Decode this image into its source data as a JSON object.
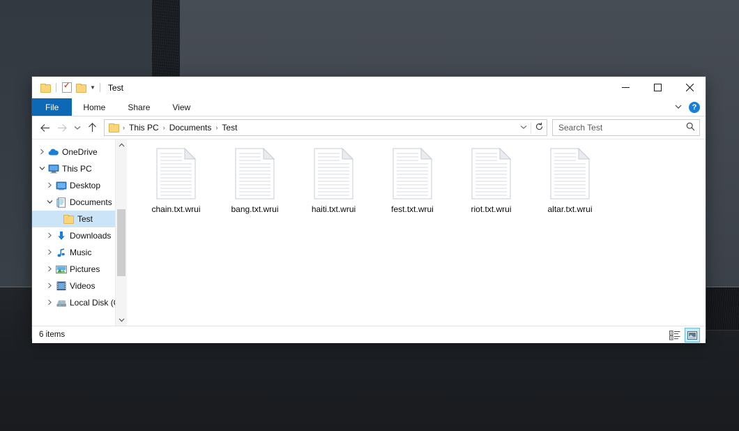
{
  "window": {
    "title": "Test",
    "quick_access": [
      {
        "icon": "folder-icon",
        "name": "qat-folder-icon"
      },
      {
        "icon": "properties-icon",
        "name": "qat-properties-icon"
      },
      {
        "icon": "new-folder-icon",
        "name": "qat-new-folder-icon"
      },
      {
        "icon": "chevron-down-icon",
        "name": "qat-customize-icon"
      }
    ],
    "controls": {
      "minimize": "–",
      "maximize": "☐",
      "close": "✕"
    }
  },
  "ribbon": {
    "tabs": [
      {
        "label": "File",
        "active": true
      },
      {
        "label": "Home",
        "active": false
      },
      {
        "label": "Share",
        "active": false
      },
      {
        "label": "View",
        "active": false
      }
    ],
    "expand_icon": "chevron-down-icon",
    "help_label": "?"
  },
  "toolbar": {
    "back_glyph": "←",
    "forward_glyph": "→",
    "recent_glyph": "⌄",
    "up_glyph": "↑",
    "address_dropdown_glyph": "⌄",
    "refresh_glyph": "↻",
    "breadcrumbs": [
      "This PC",
      "Documents",
      "Test"
    ],
    "breadcrumb_separator": "›"
  },
  "search": {
    "placeholder": "Search Test",
    "value": "",
    "icon": "search-icon"
  },
  "sidebar": {
    "items": [
      {
        "label": "OneDrive",
        "icon": "onedrive-icon",
        "arrow": "collapsed",
        "indent": 0,
        "selected": false
      },
      {
        "label": "This PC",
        "icon": "monitor-icon",
        "arrow": "expanded",
        "indent": 0,
        "selected": false
      },
      {
        "label": "Desktop",
        "icon": "desktop-icon",
        "arrow": "collapsed",
        "indent": 1,
        "selected": false
      },
      {
        "label": "Documents",
        "icon": "documents-icon",
        "arrow": "expanded",
        "indent": 1,
        "selected": false
      },
      {
        "label": "Test",
        "icon": "folder-icon",
        "arrow": "none",
        "indent": 2,
        "selected": true
      },
      {
        "label": "Downloads",
        "icon": "downloads-icon",
        "arrow": "collapsed",
        "indent": 1,
        "selected": false
      },
      {
        "label": "Music",
        "icon": "music-icon",
        "arrow": "collapsed",
        "indent": 1,
        "selected": false
      },
      {
        "label": "Pictures",
        "icon": "pictures-icon",
        "arrow": "collapsed",
        "indent": 1,
        "selected": false
      },
      {
        "label": "Videos",
        "icon": "videos-icon",
        "arrow": "collapsed",
        "indent": 1,
        "selected": false
      },
      {
        "label": "Local Disk (C:)",
        "icon": "disk-icon",
        "arrow": "collapsed",
        "indent": 1,
        "selected": false
      }
    ],
    "scroll_up_glyph": "∧",
    "scroll_down_glyph": "∨"
  },
  "files": [
    {
      "name": "chain.txt.wrui",
      "icon": "text-document-icon"
    },
    {
      "name": "bang.txt.wrui",
      "icon": "text-document-icon"
    },
    {
      "name": "haiti.txt.wrui",
      "icon": "text-document-icon"
    },
    {
      "name": "fest.txt.wrui",
      "icon": "text-document-icon"
    },
    {
      "name": "riot.txt.wrui",
      "icon": "text-document-icon"
    },
    {
      "name": "altar.txt.wrui",
      "icon": "text-document-icon"
    }
  ],
  "status": {
    "item_count": "6 items",
    "views": [
      {
        "name": "details-view-button",
        "icon": "details-view-icon",
        "active": false
      },
      {
        "name": "large-icons-view-button",
        "icon": "large-icons-view-icon",
        "active": true
      }
    ]
  },
  "colors": {
    "accent": "#0d69b5",
    "selection": "#cce4f7",
    "folder": "#fbd57a",
    "help": "#1a7fd4",
    "view_active": "#cce8f4"
  }
}
